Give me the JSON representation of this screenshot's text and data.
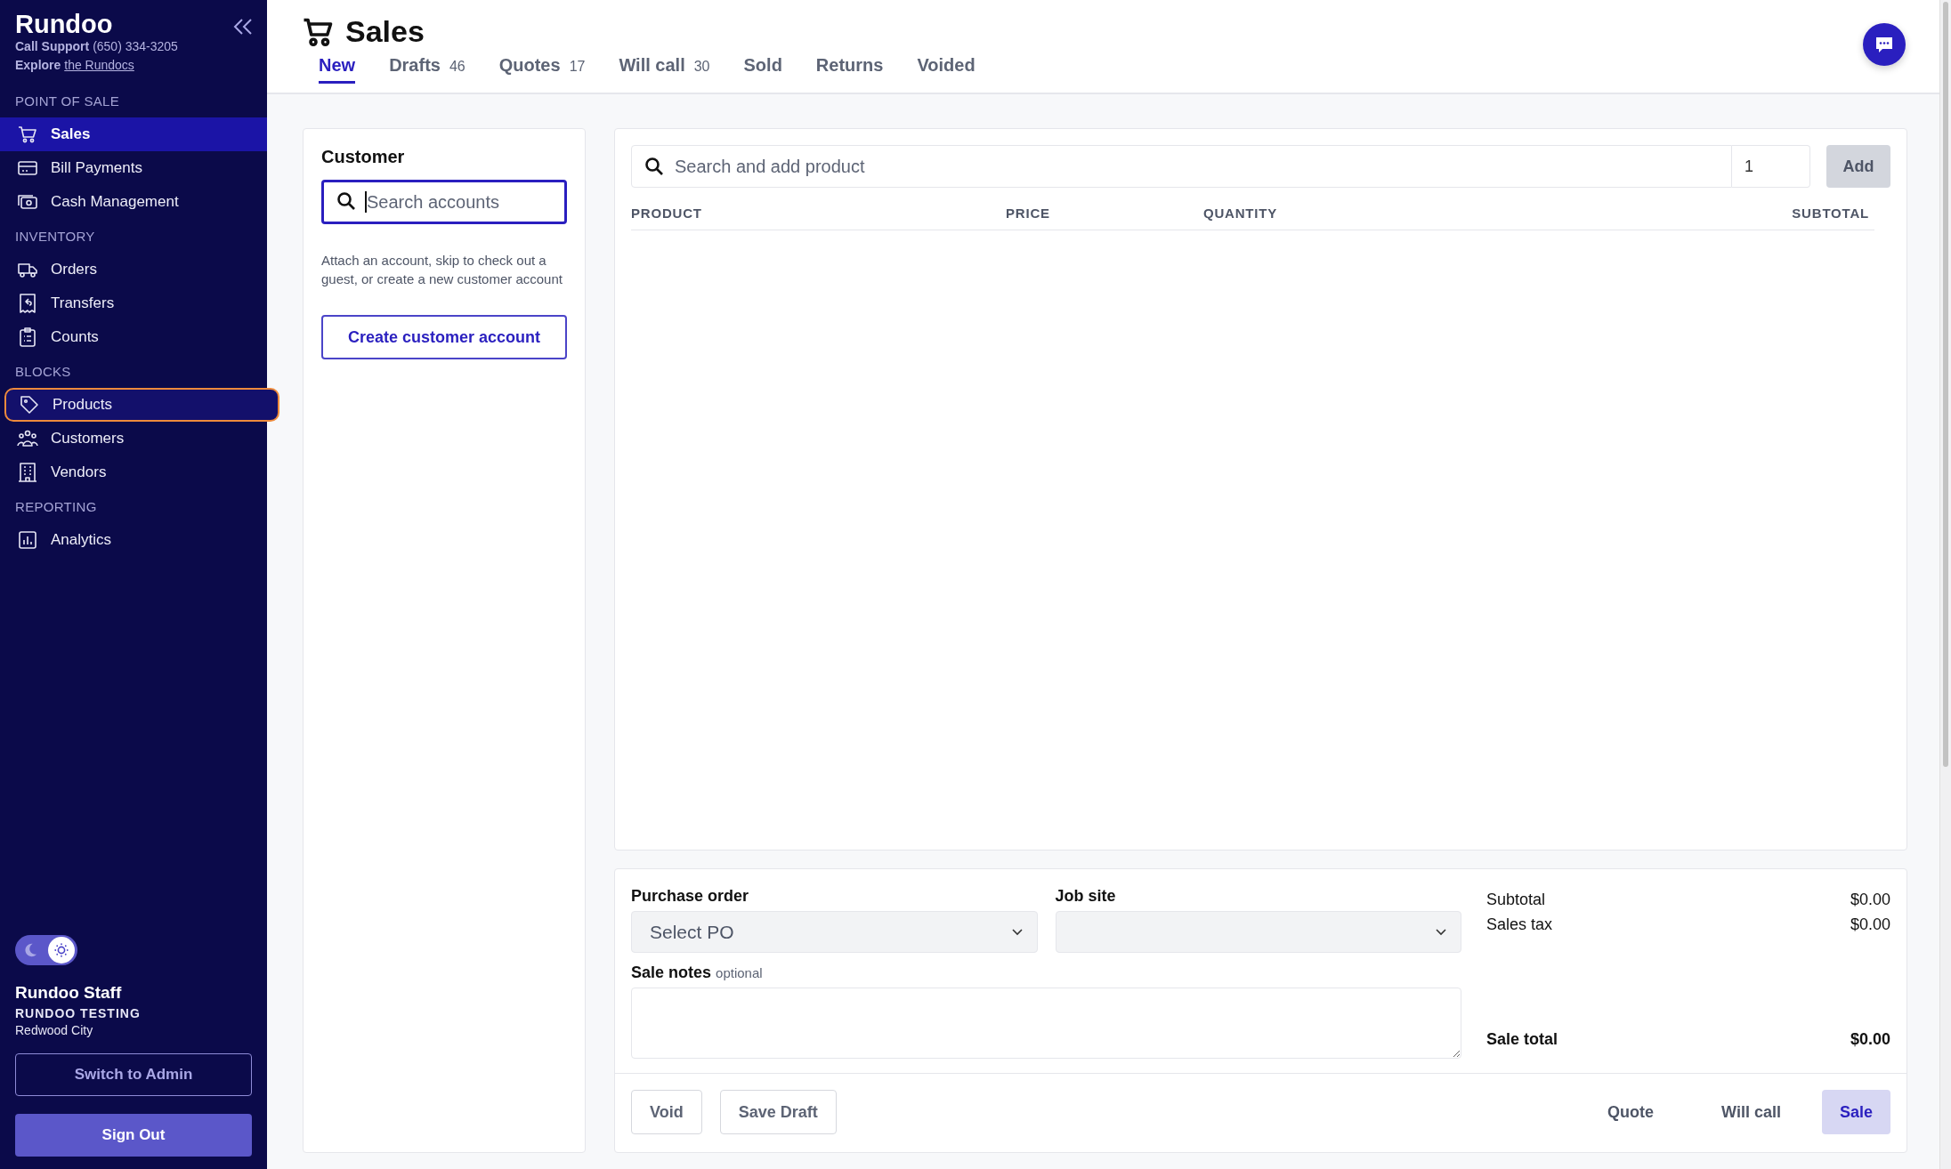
{
  "sidebar": {
    "brand": "Rundoo",
    "support_label": "Call Support",
    "support_phone": "(650) 334-3205",
    "explore_label": "Explore",
    "explore_link": "the Rundocs",
    "sections": [
      {
        "title": "POINT OF SALE",
        "items": [
          {
            "label": "Sales",
            "selected": true,
            "highlighted": false
          },
          {
            "label": "Bill Payments",
            "selected": false,
            "highlighted": false
          },
          {
            "label": "Cash Management",
            "selected": false,
            "highlighted": false
          }
        ]
      },
      {
        "title": "INVENTORY",
        "items": [
          {
            "label": "Orders",
            "selected": false,
            "highlighted": false
          },
          {
            "label": "Transfers",
            "selected": false,
            "highlighted": false
          },
          {
            "label": "Counts",
            "selected": false,
            "highlighted": false
          }
        ]
      },
      {
        "title": "BLOCKS",
        "items": [
          {
            "label": "Products",
            "selected": false,
            "highlighted": true
          },
          {
            "label": "Customers",
            "selected": false,
            "highlighted": false
          },
          {
            "label": "Vendors",
            "selected": false,
            "highlighted": false
          }
        ]
      },
      {
        "title": "REPORTING",
        "items": [
          {
            "label": "Analytics",
            "selected": false,
            "highlighted": false
          }
        ]
      }
    ],
    "light_mode": true,
    "user": {
      "name": "Rundoo Staff",
      "company": "RUNDOO TESTING",
      "location": "Redwood City"
    },
    "buttons": [
      "Switch to Admin",
      "Sign Out"
    ]
  },
  "page": {
    "title": "Sales",
    "tabs": [
      {
        "label": "New",
        "selected": true
      },
      {
        "label": "Drafts",
        "count": "46",
        "selected": false
      },
      {
        "label": "Quotes",
        "count": "17",
        "selected": false
      },
      {
        "label": "Will call",
        "count": "30",
        "selected": false
      },
      {
        "label": "Sold",
        "selected": false
      },
      {
        "label": "Returns",
        "selected": false
      },
      {
        "label": "Voided",
        "selected": false
      }
    ]
  },
  "customer": {
    "title": "Customer",
    "search": {
      "placeholder": "Search accounts",
      "focused": true
    },
    "hint": "Attach an account, skip to check out a guest, or create a new customer account",
    "button": "Create customer account"
  },
  "products": {
    "search": {
      "placeholder": "Search and add product"
    },
    "quantity": "1",
    "add_button": "Add",
    "table": {
      "columns": [
        "PRODUCT",
        "PRICE",
        "QUANTITY",
        "SUBTOTAL"
      ]
    }
  },
  "order": {
    "purchase_order": {
      "label": "Purchase order",
      "placeholder": "Select PO"
    },
    "job_site": {
      "label": "Job site"
    },
    "notes": {
      "label": "Sale notes",
      "hint": "optional"
    },
    "summary": [
      {
        "label": "Subtotal",
        "value": "$0.00",
        "bold": false
      },
      {
        "label": "Sales tax",
        "value": "$0.00",
        "bold": false
      },
      {
        "label": "Sale total",
        "value": "$0.00",
        "bold": true
      }
    ],
    "left_buttons": [
      "Void",
      "Save Draft"
    ],
    "right_buttons": [
      {
        "label": "Quote",
        "primary": false
      },
      {
        "label": "Will call",
        "primary": false
      },
      {
        "label": "Sale",
        "primary": true
      }
    ]
  }
}
